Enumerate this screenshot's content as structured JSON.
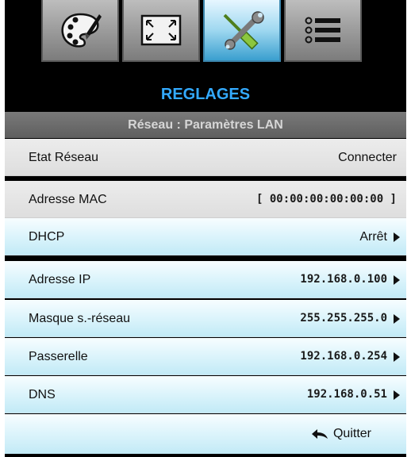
{
  "tabs": [
    {
      "id": "image",
      "icon": "palette-icon",
      "active": false
    },
    {
      "id": "display",
      "icon": "screen-resize-icon",
      "active": false
    },
    {
      "id": "settings",
      "icon": "tools-icon",
      "active": true
    },
    {
      "id": "options",
      "icon": "list-options-icon",
      "active": false
    }
  ],
  "menu": {
    "title": "REGLAGES",
    "subtitle": "Réseau : Paramètres LAN",
    "rows": [
      {
        "label": "Etat Réseau",
        "value": "Connecter",
        "has_arrow": false
      },
      {
        "label": "Adresse MAC",
        "value": "[ 00:00:00:00:00:00 ]",
        "has_arrow": false
      },
      {
        "label": "DHCP",
        "value": "Arrêt",
        "has_arrow": true
      },
      {
        "label": "Adresse IP",
        "value": "192.168.0.100",
        "has_arrow": true
      },
      {
        "label": "Masque s.-réseau",
        "value": "255.255.255.0",
        "has_arrow": true
      },
      {
        "label": "Passerelle",
        "value": "192.168.0.254",
        "has_arrow": true
      },
      {
        "label": "DNS",
        "value": "192.168.0.51",
        "has_arrow": true
      }
    ],
    "quit_label": "Quitter"
  },
  "colors": {
    "title": "#33aaff",
    "active_tab": "#9fd8f0",
    "row_highlight": "#d9f3fb",
    "row_readonly": "#e4e4e4"
  }
}
